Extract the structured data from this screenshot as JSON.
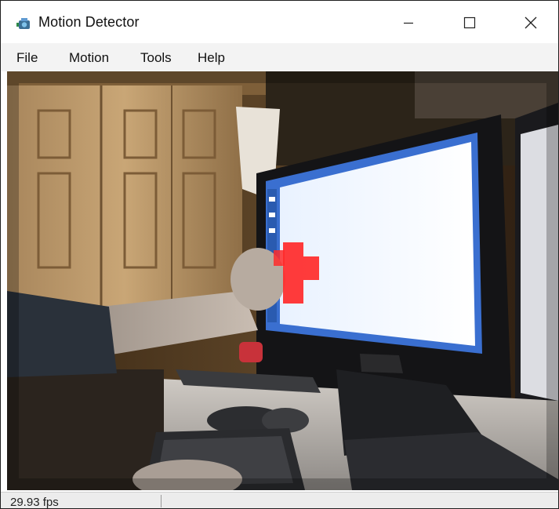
{
  "window": {
    "title": "Motion Detector",
    "app_icon": "camera-icon"
  },
  "controls": {
    "minimize": "minimize-icon",
    "maximize": "maximize-icon",
    "close": "close-icon"
  },
  "menu": [
    "File",
    "Motion",
    "Tools",
    "Help"
  ],
  "status": {
    "fps": "29.93 fps"
  },
  "colors": {
    "motion_highlight": "#ff2a2a",
    "menu_bg": "#f3f3f3",
    "status_bg": "#ececec"
  }
}
